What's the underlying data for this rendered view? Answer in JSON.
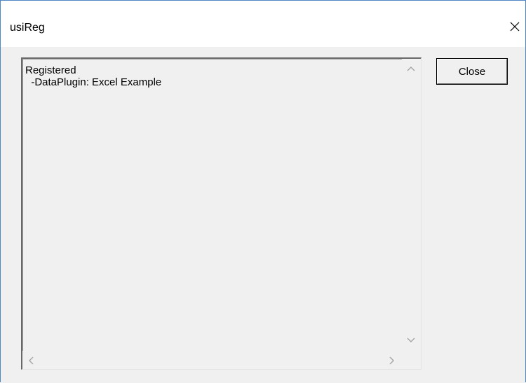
{
  "window": {
    "title": "usiReg"
  },
  "listbox": {
    "lines": [
      "Registered",
      "  -DataPlugin: Excel Example"
    ]
  },
  "buttons": {
    "close_label": "Close"
  },
  "icons": {
    "window_close": "close-icon",
    "scroll_up": "chevron-up-icon",
    "scroll_down": "chevron-down-icon",
    "scroll_left": "chevron-left-icon",
    "scroll_right": "chevron-right-icon"
  },
  "colors": {
    "window_border": "#4f86c6",
    "dialog_background": "#f0f0f0",
    "titlebar_background": "#ffffff"
  }
}
